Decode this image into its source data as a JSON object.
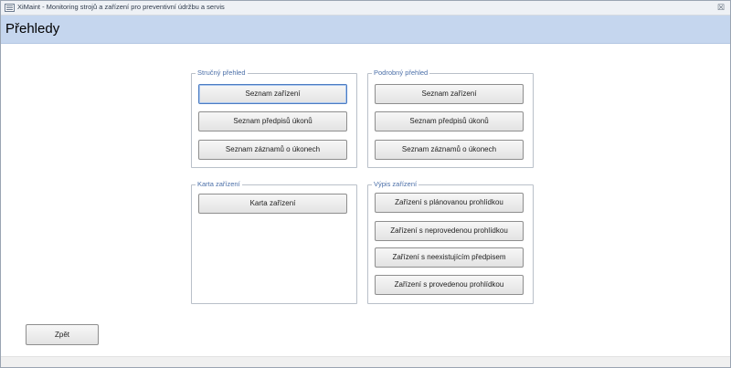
{
  "window": {
    "title": "XiMaint - Monitoring strojů a zařízení pro preventivní údržbu a servis",
    "close_glyph": "☒"
  },
  "header": {
    "title": "Přehledy"
  },
  "groups": {
    "strucny": {
      "label": "Stručný přehled",
      "buttons": [
        "Seznam zařízení",
        "Seznam předpisů úkonů",
        "Seznam záznamů o úkonech"
      ]
    },
    "podrobny": {
      "label": "Podrobný přehled",
      "buttons": [
        "Seznam zařízení",
        "Seznam předpisů úkonů",
        "Seznam záznamů o úkonech"
      ]
    },
    "karta": {
      "label": "Karta zařízení",
      "buttons": [
        "Karta zařízení"
      ]
    },
    "vypis": {
      "label": "Výpis zařízení",
      "buttons": [
        "Zařízení s plánovanou prohlídkou",
        "Zařízení s neprovedenou prohlídkou",
        "Zařízení s neexistujícím předpisem",
        "Zařízení s provedenou prohlídkou"
      ]
    }
  },
  "footer": {
    "back_label": "Zpět"
  }
}
